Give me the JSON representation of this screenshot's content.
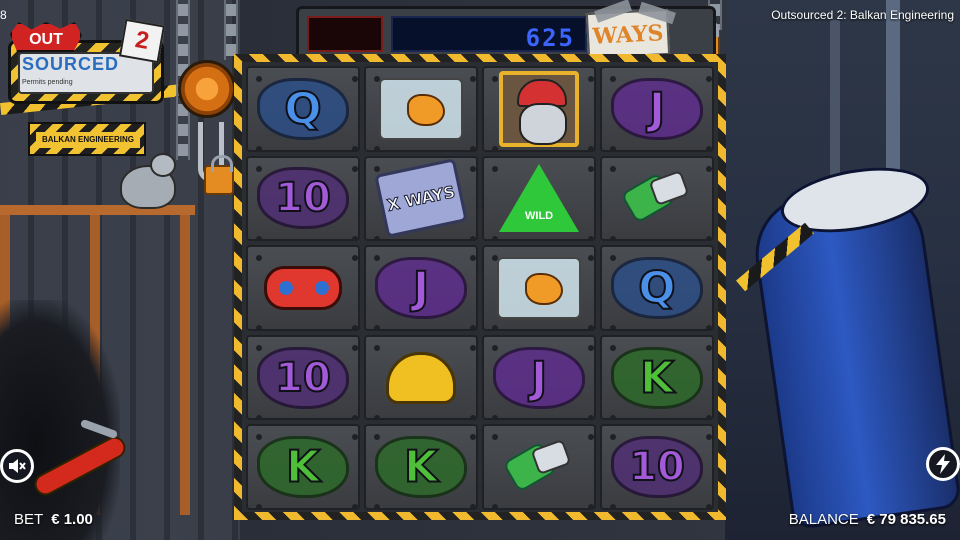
{
  "game": {
    "title": "Outsourced 2: Balkan Engineering",
    "time_fragment": "8"
  },
  "logo": {
    "out_label": "OUT",
    "word": "SOURCED",
    "tagline": "Permits pending",
    "sequel_number": "2",
    "subtitle": "BALKAN ENGINEERING"
  },
  "ways_counter": {
    "value": "625",
    "label": "WAYS"
  },
  "reels": {
    "columns": 4,
    "rows": 5,
    "grid": [
      [
        {
          "symbol": "Q",
          "kind": "letter",
          "color": "#4a90e8"
        },
        {
          "symbol": "bagged-hand",
          "kind": "icon"
        },
        {
          "symbol": "worker",
          "kind": "icon"
        },
        {
          "symbol": "J",
          "kind": "letter",
          "color": "#a25ad8"
        }
      ],
      [
        {
          "symbol": "10",
          "kind": "letter",
          "color": "#a25ad8"
        },
        {
          "symbol": "x-ways",
          "kind": "icon",
          "label": "X WAYS"
        },
        {
          "symbol": "wild",
          "kind": "icon",
          "label": "WILD"
        },
        {
          "symbol": "cans",
          "kind": "icon"
        }
      ],
      [
        {
          "symbol": "gamepad",
          "kind": "icon"
        },
        {
          "symbol": "J",
          "kind": "letter",
          "color": "#a25ad8"
        },
        {
          "symbol": "bagged-hand",
          "kind": "icon"
        },
        {
          "symbol": "Q",
          "kind": "letter",
          "color": "#4a90e8"
        }
      ],
      [
        {
          "symbol": "10",
          "kind": "letter",
          "color": "#a25ad8"
        },
        {
          "symbol": "helmet",
          "kind": "icon"
        },
        {
          "symbol": "J",
          "kind": "letter",
          "color": "#a25ad8"
        },
        {
          "symbol": "K",
          "kind": "letter",
          "color": "#4fbf3a"
        }
      ],
      [
        {
          "symbol": "K",
          "kind": "letter",
          "color": "#4fbf3a"
        },
        {
          "symbol": "K",
          "kind": "letter",
          "color": "#4fbf3a"
        },
        {
          "symbol": "cans",
          "kind": "icon"
        },
        {
          "symbol": "10",
          "kind": "letter",
          "color": "#a25ad8"
        }
      ]
    ]
  },
  "bottom_bar": {
    "bet_label": "BET",
    "bet_value": "€ 1.00",
    "balance_label": "BALANCE",
    "balance_value": "€ 79 835.65"
  },
  "controls": {
    "mute_icon": "speaker-muted-icon",
    "spin_icon": "lightning-icon"
  },
  "colors": {
    "hazard_yellow": "#f1b92d",
    "counter_blue": "#3c64ff",
    "ways_orange": "#e0842a"
  }
}
